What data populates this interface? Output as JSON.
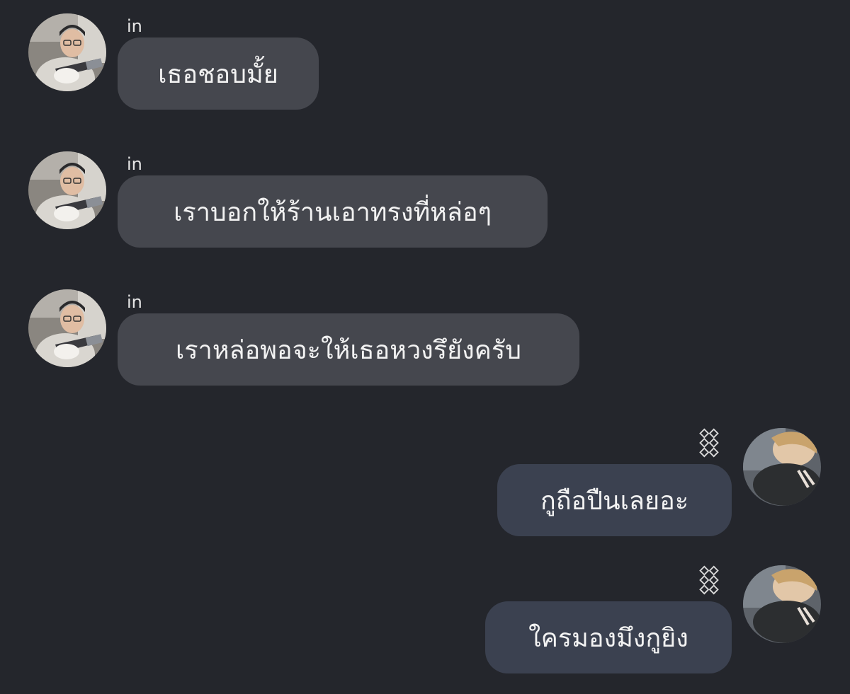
{
  "colors": {
    "background": "#24262c",
    "incoming_bubble": "#45474e",
    "outgoing_bubble": "#3b4150",
    "text": "#f2f2f2"
  },
  "incoming_sender": {
    "name": "in",
    "avatar": "guitarist-photo-avatar"
  },
  "outgoing_sender": {
    "name_icon": "chain-link-icon",
    "avatar": "selfie-photo-avatar"
  },
  "messages": [
    {
      "direction": "incoming",
      "sender": "in",
      "text": "เธอชอบมั้ย"
    },
    {
      "direction": "incoming",
      "sender": "in",
      "text": "เราบอกให้ร้านเอาทรงที่หล่อๆ"
    },
    {
      "direction": "incoming",
      "sender": "in",
      "text": "เราหล่อพอจะให้เธอหวงรึยังครับ"
    },
    {
      "direction": "outgoing",
      "text": "กูถือปืนเลยอะ"
    },
    {
      "direction": "outgoing",
      "text": "ใครมองมึงกูยิง"
    }
  ]
}
